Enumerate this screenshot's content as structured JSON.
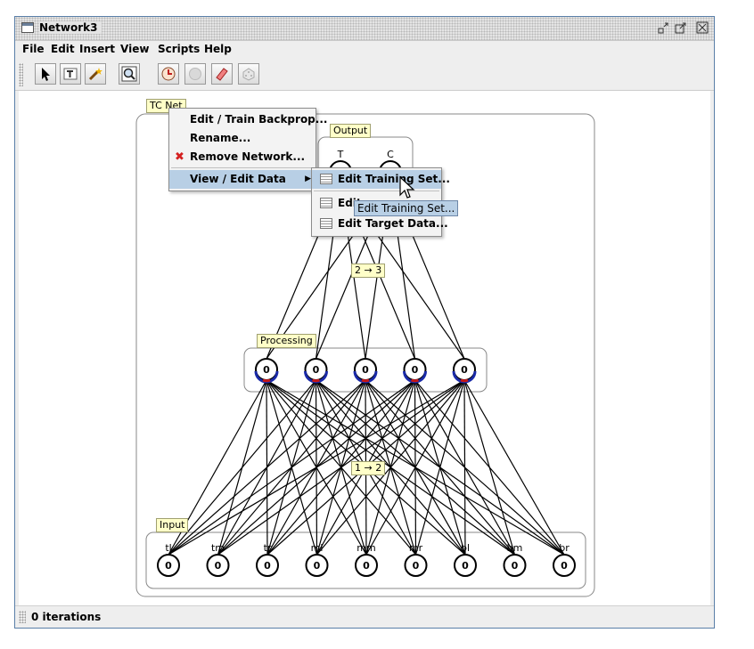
{
  "window": {
    "title": "Network3"
  },
  "menu": [
    "File",
    "Edit",
    "Insert",
    "View",
    "Scripts",
    "Help"
  ],
  "toolbar": {
    "tools": [
      "select-arrow-icon",
      "text-tool-icon",
      "wand-icon",
      "zoom-icon",
      "network-clock-icon",
      "stop-icon",
      "eraser-icon",
      "dice-icon"
    ]
  },
  "network": {
    "tag": "TC Net",
    "output_label": "Output",
    "processing_label": "Processing",
    "input_label": "Input",
    "conn_23": "2 → 3",
    "conn_12": "1 → 2",
    "output_names": [
      "T",
      "C"
    ],
    "processing_values": [
      "0",
      "0",
      "0",
      "0",
      "0"
    ],
    "input_names": [
      "tl",
      "tm",
      "tr",
      "ml",
      "mm",
      "mr",
      "bl",
      "bm",
      "br"
    ],
    "input_values": [
      "0",
      "0",
      "0",
      "0",
      "0",
      "0",
      "0",
      "0",
      "0"
    ]
  },
  "context_menu": {
    "items": [
      "Edit / Train Backprop...",
      "Rename...",
      "Remove Network...",
      "View / Edit Data"
    ]
  },
  "submenu": {
    "items": [
      "Edit Training Set...",
      "Edit",
      "Edit Target Data..."
    ]
  },
  "tooltip": "Edit Training Set...",
  "status": {
    "text": "0 iterations"
  },
  "colors": {
    "weight_blue": "#1a2aa8",
    "weight_red": "#c81818",
    "highlight": "#b8cfe5",
    "tag_yellow": "#ffffc8"
  }
}
